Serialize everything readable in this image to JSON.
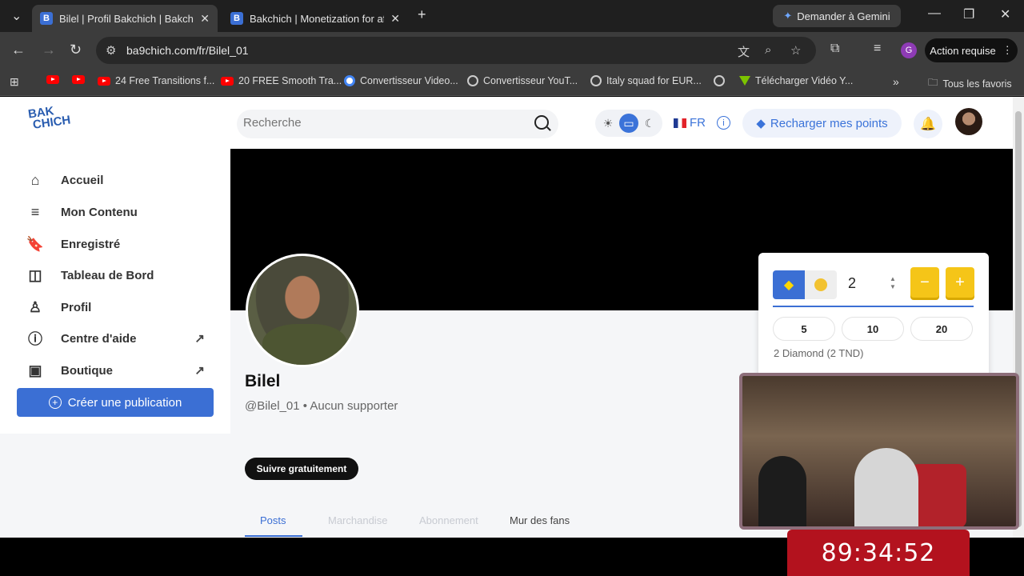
{
  "browser": {
    "tabs": [
      {
        "favicon": "B",
        "title": "Bilel | Profil Bakchich | Bakchich"
      },
      {
        "favicon": "B",
        "title": "Bakchich | Monetization for afri"
      }
    ],
    "gemini_label": "Demander à Gemini",
    "url": "ba9chich.com/fr/Bilel_01",
    "profile_initial": "G",
    "action_label": "Action requise",
    "bookmarks": [
      "24 Free Transitions f...",
      "20 FREE Smooth Tra...",
      "Convertisseur Video...",
      "Convertisseur YouT...",
      "Italy squad for EUR...",
      "Télécharger Vidéo Y..."
    ],
    "all_bookmarks": "Tous les favoris"
  },
  "header": {
    "logo_line1": "BAK",
    "logo_line2": "CHICH",
    "search_placeholder": "Recherche",
    "lang": "FR",
    "recharge_label": "Recharger mes points"
  },
  "sidebar": {
    "items": [
      {
        "label": "Accueil",
        "icon": "home-icon"
      },
      {
        "label": "Mon Contenu",
        "icon": "list-icon"
      },
      {
        "label": "Enregistré",
        "icon": "bookmark-icon"
      },
      {
        "label": "Tableau de Bord",
        "icon": "dashboard-icon"
      },
      {
        "label": "Profil",
        "icon": "user-icon"
      },
      {
        "label": "Centre d'aide",
        "icon": "info-icon"
      },
      {
        "label": "Boutique",
        "icon": "wallet-icon"
      }
    ],
    "create_label": "Créer une publication"
  },
  "profile": {
    "name": "Bilel",
    "handle": "@Bilel_01 • Aucun supporter",
    "follow_label": "Suivre gratuitement",
    "tabs": [
      "Posts",
      "Marchandise",
      "Abonnement",
      "Mur des fans"
    ]
  },
  "donate": {
    "amount": "2",
    "presets": [
      "5",
      "10",
      "20"
    ],
    "total": "2 Diamond (2 TND)"
  },
  "overlay": {
    "timer": "89:34:52"
  },
  "colors": {
    "accent": "#3b6fd4",
    "gold": "#f5c518",
    "timer_bg": "#b3121e"
  }
}
